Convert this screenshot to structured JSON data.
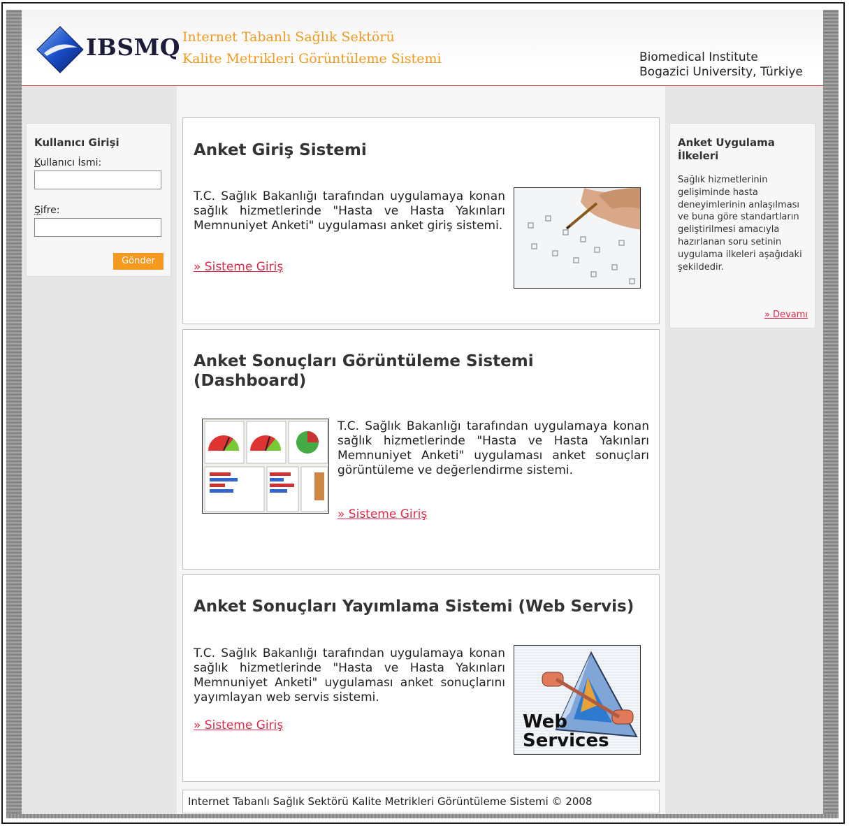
{
  "header": {
    "logo_text": "IBSMQ",
    "title_line1": "Internet Tabanlı Sağlık Sektörü",
    "title_line2": "Kalite Metrikleri Görüntüleme Sistemi",
    "institute_line1": "Biomedical Institute",
    "institute_line2": "Bogazici University, Türkiye"
  },
  "login": {
    "title": "Kullanıcı Girişi",
    "username_label_first": "K",
    "username_label_rest": "ullanıcı İsmi:",
    "username_value": "",
    "password_label_first": "Ş",
    "password_label_rest": "ifre:",
    "password_value": "",
    "submit_label": "Gönder"
  },
  "cards": [
    {
      "title": "Anket Giriş Sistemi",
      "text": "T.C. Sağlık Bakanlığı tarafından uygulamaya konan sağlık hizmetlerinde \"Hasta ve Hasta Yakınları Memnuniyet Anketi\" uygulaması anket giriş sistemi.",
      "link": "» Sisteme Giriş"
    },
    {
      "title": "Anket Sonuçları Görüntüleme Sistemi (Dashboard)",
      "text": "T.C. Sağlık Bakanlığı tarafından uygulamaya konan sağlık hizmetlerinde \"Hasta ve Hasta Yakınları Memnuniyet Anketi\" uygulaması anket sonuçları görüntüleme ve değerlendirme sistemi.",
      "link": "» Sisteme Giriş"
    },
    {
      "title": "Anket Sonuçları Yayımlama Sistemi (Web Servis)",
      "text": "T.C. Sağlık Bakanlığı tarafından uygulamaya konan sağlık hizmetlerinde \"Hasta ve Hasta Yakınları Memnuniyet Anketi\" uygulaması anket sonuçlarını yayımlayan web servis sistemi.",
      "link": "» Sisteme Giriş",
      "image_text_line1": "Web",
      "image_text_line2": "Services"
    }
  ],
  "sidebar_right": {
    "title": "Anket Uygulama İlkeleri",
    "text": "Sağlık hizmetlerinin gelişiminde hasta deneyimlerinin anlaşılması ve buna göre standartların geliştirilmesi amacıyla hazırlanan soru setinin uygulama ilkeleri aşağıdaki şekildedir.",
    "link": "» Devamı"
  },
  "footer": {
    "text": "Internet Tabanlı Sağlık Sektörü Kalite Metrikleri Görüntüleme Sistemi © 2008"
  },
  "colors": {
    "accent_orange": "#f59a1e",
    "link_red": "#e0284a",
    "header_rule": "#d94a5a"
  }
}
